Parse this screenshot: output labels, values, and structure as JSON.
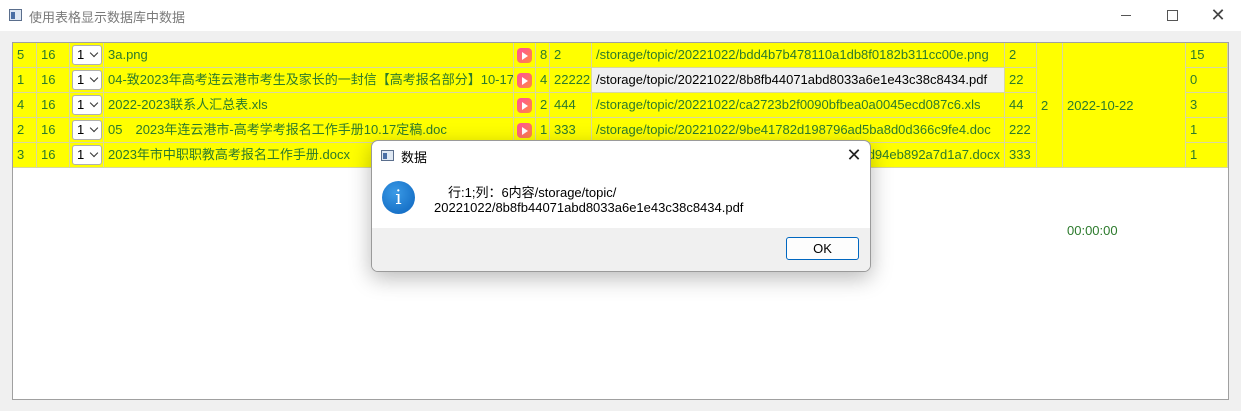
{
  "window": {
    "title": "使用表格显示数据库中数据",
    "icon": "app-window-icon"
  },
  "rows": [
    {
      "c0": "5",
      "c1": "16",
      "combo": "1",
      "name": "3a.png",
      "count": "8",
      "size": "2",
      "path": "/storage/topic/20221022/bdd4b7b478110a1db8f0182b311cc00e.png",
      "num": "2",
      "last": "15"
    },
    {
      "c0": "1",
      "c1": "16",
      "combo": "1",
      "name": "04-致2023年高考连云港市考生及家长的一封信【高考报名部分】10-17.pdf",
      "count": "4",
      "size": "22222",
      "path": "/storage/topic/20221022/8b8fb44071abd8033a6e1e43c38c8434.pdf",
      "num": "22",
      "last": "0"
    },
    {
      "c0": "4",
      "c1": "16",
      "combo": "1",
      "name": "2022-2023联系人汇总表.xls",
      "count": "2",
      "size": "444",
      "path": "/storage/topic/20221022/ca2723b2f0090bfbea0a0045ecd087c6.xls",
      "num": "44",
      "last": "3"
    },
    {
      "c0": "2",
      "c1": "16",
      "combo": "1",
      "name": "05　2023年连云港市-高考学考报名工作手册10.17定稿.doc",
      "count": "1",
      "size": "333",
      "path": "/storage/topic/20221022/9be41782d198796ad5ba8d0d366c9fe4.doc",
      "num": "222",
      "last": "1"
    },
    {
      "c0": "3",
      "c1": "16",
      "combo": "1",
      "name": "2023年市中职职教高考报名工作手册.docx",
      "count": "",
      "size": "",
      "path": "d94eb892a7d1a7.docx",
      "num": "333",
      "last": "1"
    }
  ],
  "merged": {
    "col10": "2",
    "col11": "2022-10-22 00:00:00"
  },
  "dialog": {
    "title": "数据",
    "message_line1": "行:1;列：6内容/storage/topic/",
    "message_line2": "20221022/8b8fb44071abd8033a6e1e43c38c8434.pdf",
    "ok_label": "OK",
    "icon": "info-icon"
  },
  "colors": {
    "cell_bg": "#ffff00",
    "cell_text": "#2c7a2c",
    "accent": "#0067c0"
  }
}
